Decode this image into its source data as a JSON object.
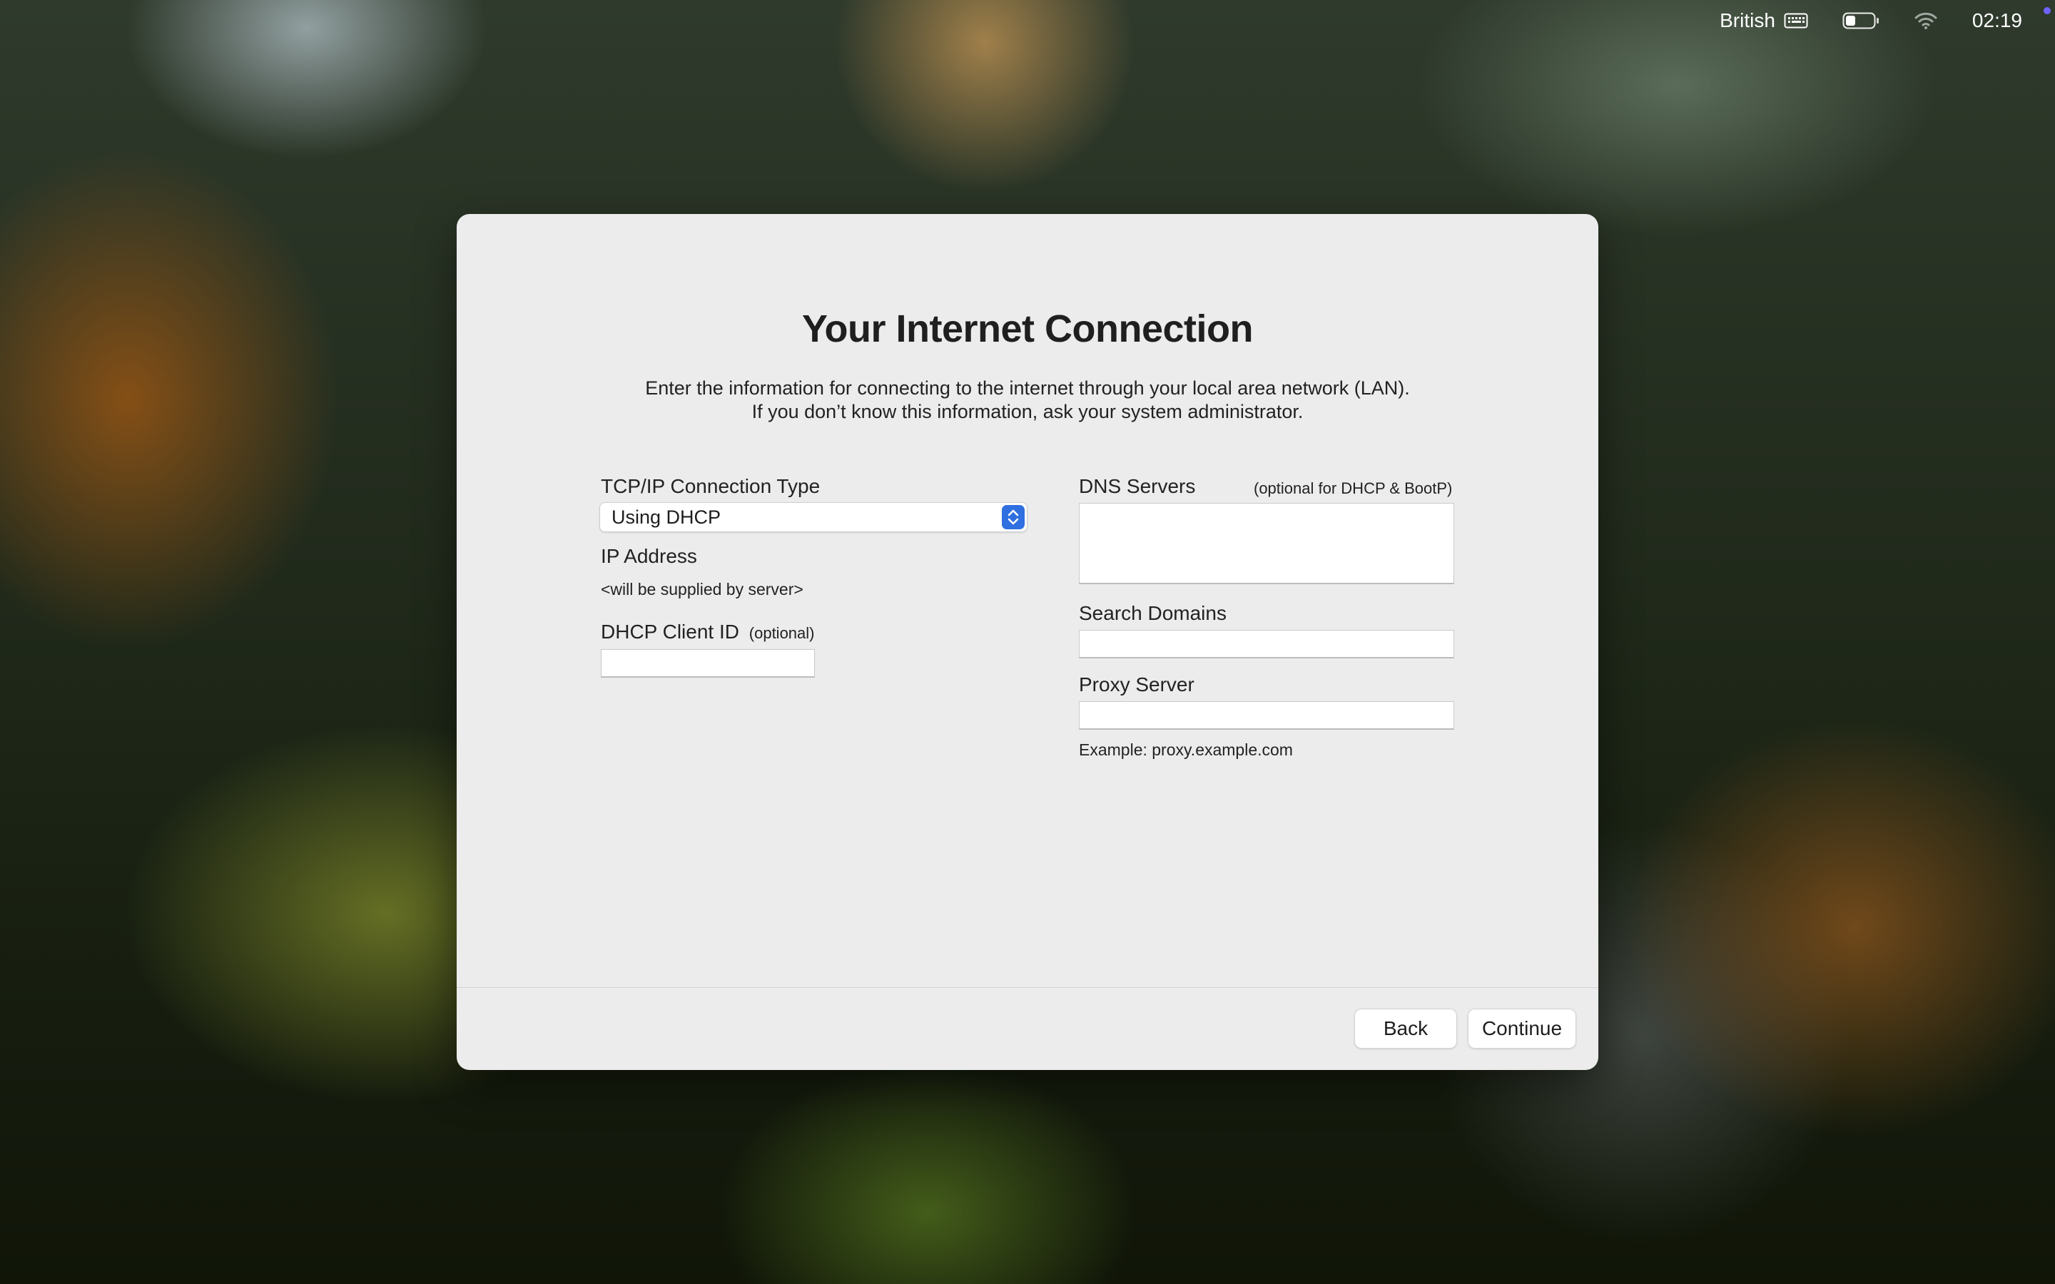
{
  "menubar": {
    "input_source": "British",
    "clock": "02:19",
    "icons": [
      "keyboard-icon",
      "battery-icon",
      "wifi-icon"
    ],
    "battery_level": 0.35
  },
  "dialog": {
    "title": "Your Internet Connection",
    "subtitle_line1": "Enter the information for connecting to the internet through your local area network (LAN).",
    "subtitle_line2": "If you don’t know this information, ask your system administrator.",
    "tcpip": {
      "label": "TCP/IP Connection Type",
      "value": "Using DHCP"
    },
    "ip_address": {
      "label": "IP Address",
      "value": "<will be supplied by server>"
    },
    "dhcp_client_id": {
      "label": "DHCP Client ID",
      "note": "(optional)",
      "value": ""
    },
    "dns_servers": {
      "label": "DNS Servers",
      "note": "(optional for DHCP & BootP)",
      "value": ""
    },
    "search_domains": {
      "label": "Search Domains",
      "value": ""
    },
    "proxy_server": {
      "label": "Proxy Server",
      "value": "",
      "example": "Example: proxy.example.com"
    },
    "buttons": {
      "back": "Back",
      "continue": "Continue"
    }
  },
  "colors": {
    "dialog_bg": "#ececec",
    "accent": "#2f6fe0",
    "text": "#222222"
  }
}
